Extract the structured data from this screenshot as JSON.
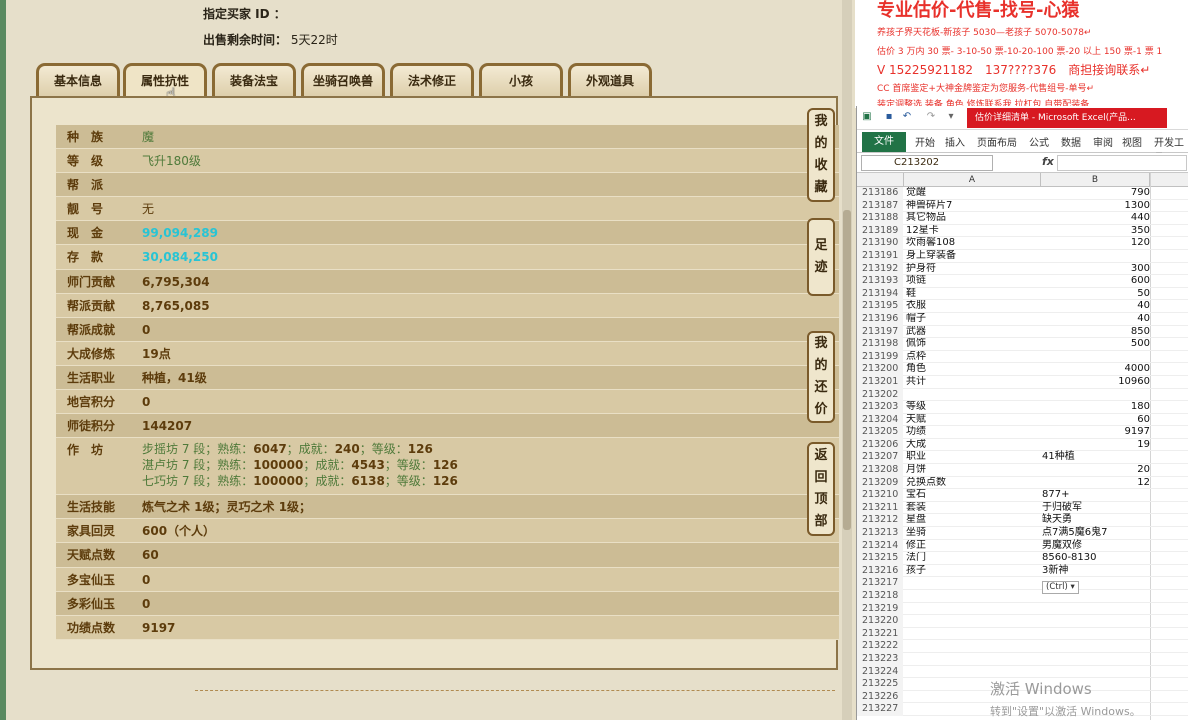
{
  "seller": {
    "buyer_label": "指定买家 ID ：",
    "remain_label": "出售剩余时间：",
    "remain_value": "5天22时"
  },
  "tabs": [
    "基本信息",
    "属性抗性",
    "装备法宝",
    "坐骑召唤兽",
    "法术修正",
    "小孩",
    "外观道具"
  ],
  "side_buttons": [
    "我的收藏",
    "足迹",
    "我的还价",
    "返回顶部"
  ],
  "attributes": [
    {
      "label": "种　族",
      "value": "魔",
      "style": "green"
    },
    {
      "label": "等　级",
      "value": "飞升180级",
      "style": "green"
    },
    {
      "label": "帮　派",
      "value": "",
      "style": "green"
    },
    {
      "label": "靓　号",
      "value": "无",
      "style": "plain"
    },
    {
      "label": "现　金",
      "value": "99,094,289",
      "style": "cyan"
    },
    {
      "label": "存　款",
      "value": "30,084,250",
      "style": "cyan"
    },
    {
      "label": "师门贡献",
      "value": "6,795,304",
      "style": "bold"
    },
    {
      "label": "帮派贡献",
      "value": "8,765,085",
      "style": "bold"
    },
    {
      "label": "帮派成就",
      "value": "0",
      "style": "bold"
    },
    {
      "label": "大成修炼",
      "value": "19点",
      "style": "bold"
    },
    {
      "label": "生活职业",
      "value": "种植，41级",
      "style": "bold"
    },
    {
      "label": "地宫积分",
      "value": "0",
      "style": "bold"
    },
    {
      "label": "师徒积分",
      "value": "144207",
      "style": "bold"
    }
  ],
  "workshop": {
    "label": "作　坊",
    "lines": [
      {
        "name": "步摇坊 7 段；熟练：",
        "skill": "6047",
        "mid": "；成就：",
        "achieve": "240",
        "lv": "；等级：",
        "level": "126"
      },
      {
        "name": "湛卢坊 7 段；熟练：",
        "skill": "100000",
        "mid": "；成就：",
        "achieve": "4543",
        "lv": "；等级：",
        "level": "126"
      },
      {
        "name": "七巧坊 7 段；熟练：",
        "skill": "100000",
        "mid": "；成就：",
        "achieve": "6138",
        "lv": "；等级：",
        "level": "126"
      }
    ]
  },
  "attributes2": [
    {
      "label": "生活技能",
      "value": "炼气之术 1级；灵巧之术 1级；"
    },
    {
      "label": "家具回灵",
      "value": "600（个人）"
    },
    {
      "label": "天赋点数",
      "value": "60"
    },
    {
      "label": "多宝仙玉",
      "value": "0"
    },
    {
      "label": "多彩仙玉",
      "value": "0"
    },
    {
      "label": "功绩点数",
      "value": "9197"
    }
  ],
  "doc": {
    "title": "专业估价-代售-找号-心猿",
    "line1": "养孩子界天花板-新孩子 5030—老孩子 5070-5078↵",
    "line2": "估价 3 万内 30 票- 3-10-50 票-10-20-100 票-20 以上 150 票-1 票 1",
    "line3": "V 15225921182　137????376　商担接询联系↵",
    "line4": "CC 首席鉴定+大神金牌鉴定为您服务-代售组号-单号↵",
    "line5": "装定调整选 装备 角色 修炼联系我 拉杠包 自带配装备"
  },
  "excel": {
    "title": "估价详细清单 - Microsoft Excel(产品...",
    "ribbon": [
      "文件",
      "开始",
      "插入",
      "页面布局",
      "公式",
      "数据",
      "审阅",
      "视图",
      "开发工具"
    ],
    "name_box": "C213202",
    "col_a": "A",
    "col_b": "B",
    "ctrl_tag": "(Ctrl) ▾",
    "rows": [
      {
        "n": "213186",
        "a": "觉醒",
        "b": "790",
        "align": "right"
      },
      {
        "n": "213187",
        "a": "神兽碎片7",
        "b": "1300",
        "align": "right"
      },
      {
        "n": "213188",
        "a": "其它物品",
        "b": "440",
        "align": "right"
      },
      {
        "n": "213189",
        "a": "12星卡",
        "b": "350",
        "align": "right"
      },
      {
        "n": "213190",
        "a": "坎雨馨108",
        "b": "120",
        "align": "right"
      },
      {
        "n": "213191",
        "a": "身上穿装备",
        "b": "",
        "align": "right"
      },
      {
        "n": "213192",
        "a": "护身符",
        "b": "300",
        "align": "right"
      },
      {
        "n": "213193",
        "a": "项链",
        "b": "600",
        "align": "right"
      },
      {
        "n": "213194",
        "a": "鞋",
        "b": "50",
        "align": "right"
      },
      {
        "n": "213195",
        "a": "衣服",
        "b": "40",
        "align": "right"
      },
      {
        "n": "213196",
        "a": "帽子",
        "b": "40",
        "align": "right"
      },
      {
        "n": "213197",
        "a": "武器",
        "b": "850",
        "align": "right"
      },
      {
        "n": "213198",
        "a": "佩饰",
        "b": "500",
        "align": "right"
      },
      {
        "n": "213199",
        "a": "点枠",
        "b": "",
        "align": "right"
      },
      {
        "n": "213200",
        "a": "角色",
        "b": "4000",
        "align": "right"
      },
      {
        "n": "213201",
        "a": "共计",
        "b": "10960",
        "align": "right"
      },
      {
        "n": "213202",
        "a": "",
        "b": "",
        "align": "right"
      },
      {
        "n": "213203",
        "a": "等级",
        "b": "180",
        "align": "right"
      },
      {
        "n": "213204",
        "a": "天赋",
        "b": "60",
        "align": "right"
      },
      {
        "n": "213205",
        "a": "功绩",
        "b": "9197",
        "align": "right"
      },
      {
        "n": "213206",
        "a": "大成",
        "b": "19",
        "align": "right"
      },
      {
        "n": "213207",
        "a": "职业",
        "b": "41种植",
        "align": "left"
      },
      {
        "n": "213208",
        "a": "月饼",
        "b": "20",
        "align": "right"
      },
      {
        "n": "213209",
        "a": "兑换点数",
        "b": "12",
        "align": "right"
      },
      {
        "n": "213210",
        "a": "宝石",
        "b": "877+",
        "align": "left"
      },
      {
        "n": "213211",
        "a": "套装",
        "b": "于归破军",
        "align": "left"
      },
      {
        "n": "213212",
        "a": "星盘",
        "b": "缺天勇",
        "align": "left"
      },
      {
        "n": "213213",
        "a": "坐骑",
        "b": "点7满5魔6鬼7",
        "align": "left"
      },
      {
        "n": "213214",
        "a": "修正",
        "b": "男魔双修",
        "align": "left"
      },
      {
        "n": "213215",
        "a": "法门",
        "b": "8560-8130",
        "align": "left"
      },
      {
        "n": "213216",
        "a": "孩子",
        "b": "3新神",
        "align": "left"
      },
      {
        "n": "213217",
        "a": "",
        "b": "",
        "align": "right"
      },
      {
        "n": "213218",
        "a": "",
        "b": "",
        "align": "right"
      },
      {
        "n": "213219",
        "a": "",
        "b": "",
        "align": "right"
      },
      {
        "n": "213220",
        "a": "",
        "b": "",
        "align": "right"
      },
      {
        "n": "213221",
        "a": "",
        "b": "",
        "align": "right"
      },
      {
        "n": "213222",
        "a": "",
        "b": "",
        "align": "right"
      },
      {
        "n": "213223",
        "a": "",
        "b": "",
        "align": "right"
      },
      {
        "n": "213224",
        "a": "",
        "b": "",
        "align": "right"
      },
      {
        "n": "213225",
        "a": "",
        "b": "",
        "align": "right"
      },
      {
        "n": "213226",
        "a": "",
        "b": "",
        "align": "right"
      },
      {
        "n": "213227",
        "a": "",
        "b": "",
        "align": "right"
      }
    ]
  },
  "watermark": {
    "line1": "激活 Windows",
    "line2": "转到\"设置\"以激活 Windows。"
  }
}
